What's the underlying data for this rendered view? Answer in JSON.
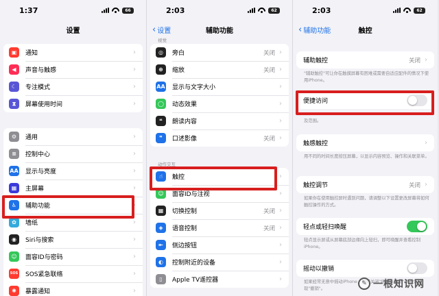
{
  "colors": {
    "ios_blue": "#1f72e8",
    "highlight_red": "#d81e1e",
    "toggle_green": "#34c759"
  },
  "panel1": {
    "time": "1:37",
    "battery": "66",
    "title": "设置",
    "group1": [
      {
        "label": "通知",
        "icon": "bell-icon",
        "color": "#ff3b30",
        "glyph": "▣"
      },
      {
        "label": "声音与触感",
        "icon": "speaker-icon",
        "color": "#ff2d55",
        "glyph": "◀"
      },
      {
        "label": "专注模式",
        "icon": "moon-icon",
        "color": "#5856d6",
        "glyph": "☾"
      },
      {
        "label": "屏幕使用时间",
        "icon": "hourglass-icon",
        "color": "#5856d6",
        "glyph": "⧗"
      }
    ],
    "group2": [
      {
        "label": "通用",
        "icon": "gear-icon",
        "color": "#8e8e93",
        "glyph": "⚙"
      },
      {
        "label": "控制中心",
        "icon": "toggles-icon",
        "color": "#8e8e93",
        "glyph": "≡"
      },
      {
        "label": "显示与亮度",
        "icon": "text-size-icon",
        "color": "#1f72e8",
        "glyph": "AA"
      },
      {
        "label": "主屏幕",
        "icon": "home-grid-icon",
        "color": "#3a3adb",
        "glyph": "▦"
      },
      {
        "label": "辅助功能",
        "icon": "accessibility-icon",
        "color": "#1f72e8",
        "glyph": "♿"
      },
      {
        "label": "墙纸",
        "icon": "flower-icon",
        "color": "#34aadc",
        "glyph": "✿"
      },
      {
        "label": "Siri与搜索",
        "icon": "siri-icon",
        "color": "#222222",
        "glyph": "◉"
      },
      {
        "label": "面容ID与密码",
        "icon": "face-id-icon",
        "color": "#34c759",
        "glyph": "☺"
      },
      {
        "label": "SOS紧急联络",
        "icon": "sos-icon",
        "color": "#ff3b30",
        "glyph": "SOS"
      },
      {
        "label": "暴露通知",
        "icon": "exposure-icon",
        "color": "#ff3b30",
        "glyph": "✺"
      }
    ]
  },
  "panel2": {
    "time": "2:03",
    "battery": "62",
    "back_label": "设置",
    "title": "辅助功能",
    "section_top": "视觉",
    "group1": [
      {
        "label": "旁白",
        "value": "关闭",
        "icon": "voiceover-icon",
        "color": "#222222",
        "glyph": "◎"
      },
      {
        "label": "缩放",
        "value": "关闭",
        "icon": "zoom-icon",
        "color": "#222222",
        "glyph": "⊕"
      },
      {
        "label": "显示与文字大小",
        "value": "",
        "icon": "text-size-icon",
        "color": "#1f72e8",
        "glyph": "AA"
      },
      {
        "label": "动态效果",
        "value": "",
        "icon": "motion-icon",
        "color": "#34c759",
        "glyph": "◯"
      },
      {
        "label": "朗读内容",
        "value": "",
        "icon": "speech-icon",
        "color": "#222222",
        "glyph": "❝"
      },
      {
        "label": "口述影像",
        "value": "关闭",
        "icon": "audio-description-icon",
        "color": "#1f72e8",
        "glyph": "❞"
      }
    ],
    "section_interaction": "动作交互",
    "group2": [
      {
        "label": "触控",
        "value": "",
        "icon": "touch-hand-icon",
        "color": "#1f72e8",
        "glyph": "☝"
      },
      {
        "label": "面容ID与注视",
        "value": "",
        "icon": "face-id-icon",
        "color": "#34c759",
        "glyph": "☺"
      },
      {
        "label": "切换控制",
        "value": "关闭",
        "icon": "switch-control-icon",
        "color": "#222222",
        "glyph": "▦"
      },
      {
        "label": "语音控制",
        "value": "关闭",
        "icon": "voice-control-icon",
        "color": "#1f72e8",
        "glyph": "◈"
      },
      {
        "label": "侧边按钮",
        "value": "",
        "icon": "side-button-icon",
        "color": "#1f72e8",
        "glyph": "⇤"
      },
      {
        "label": "控制附近的设备",
        "value": "",
        "icon": "nearby-devices-icon",
        "color": "#1f72e8",
        "glyph": "◐"
      },
      {
        "label": "Apple TV遥控器",
        "value": "",
        "icon": "remote-icon",
        "color": "#8e8e93",
        "glyph": "▯"
      }
    ]
  },
  "panel3": {
    "time": "2:03",
    "battery": "62",
    "back_label": "辅助功能",
    "title": "触控",
    "assistive_touch": {
      "label": "辅助触控",
      "value": "关闭"
    },
    "assistive_note": "\"辅助触控\"可让你在触摸屏幕有困难或需要自适应配件的情况下使用iPhone。",
    "reachability": {
      "label": "便捷访问"
    },
    "reachability_note": "及范围。",
    "haptic_touch": {
      "label": "触感触控"
    },
    "haptic_note": "用不同的时间长度按压屏幕，以显示内容预览、操作和关联菜单。",
    "touch_accommodations": {
      "label": "触控调节",
      "value": "关闭"
    },
    "touch_acc_note": "如果你在使用触控屏时遇到问题，请调整以下设置更改屏幕将如何触控操作的方式。",
    "tap_to_wake": {
      "label": "轻点或轻扫唤醒"
    },
    "tap_wake_note": "轻点显示屏或从屏幕底部边缘向上轻扫，即可唤醒并查看控制iPhone。",
    "shake_to_undo": {
      "label": "摇动以撤销"
    },
    "shake_note": "如果经常无意中摇动iPhone，则可关闭\"摇动以撤销\"来避免出现\"撤销\"。"
  },
  "watermark": {
    "text": "一根知识网"
  }
}
